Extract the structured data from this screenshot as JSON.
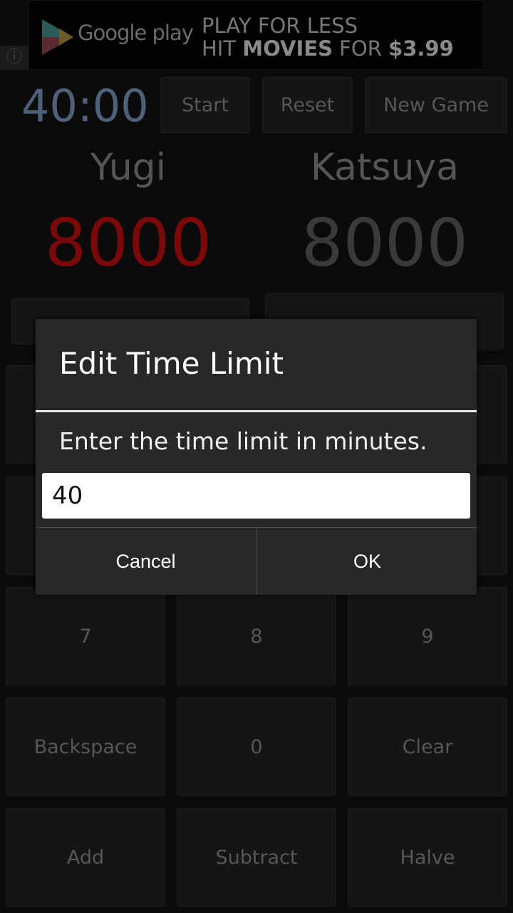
{
  "ad": {
    "brand": "Google play",
    "line1": "PLAY FOR LESS",
    "line2_a": "HIT ",
    "line2_b": "MOVIES",
    "line2_c": " FOR ",
    "line2_d": "$3.99",
    "info_icon": "info-icon"
  },
  "timer": "40:00",
  "toolbar": {
    "start": "Start",
    "reset": "Reset",
    "new_game": "New Game"
  },
  "players": [
    {
      "name": "Yugi",
      "life": "8000",
      "color": "#7a0a0a"
    },
    {
      "name": "Katsuya",
      "life": "8000",
      "color": "#3a3a3a"
    }
  ],
  "keypad": [
    [
      "7",
      "8",
      "9"
    ],
    [
      "Backspace",
      "0",
      "Clear"
    ],
    [
      "Add",
      "Subtract",
      "Halve"
    ]
  ],
  "dialog": {
    "title": "Edit Time Limit",
    "message": "Enter the time limit in minutes.",
    "value": "40",
    "cancel": "Cancel",
    "ok": "OK"
  }
}
